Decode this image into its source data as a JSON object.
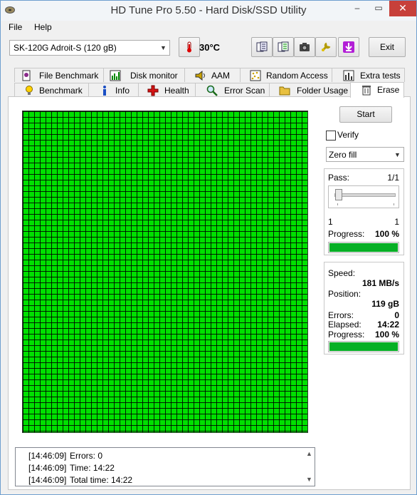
{
  "window": {
    "title": "HD Tune Pro 5.50 - Hard Disk/SSD Utility",
    "minimize": "–",
    "maximize": "▭",
    "close": "✕"
  },
  "menu": {
    "file": "File",
    "help": "Help"
  },
  "toolbar": {
    "drive": "SK-120G Adroit-S (120 gB)",
    "temperature": "30°C",
    "exit_label": "Exit"
  },
  "tabs_top": [
    {
      "label": "File Benchmark",
      "icon": "file-benchmark-icon"
    },
    {
      "label": "Disk monitor",
      "icon": "disk-monitor-icon"
    },
    {
      "label": "AAM",
      "icon": "speaker-icon"
    },
    {
      "label": "Random Access",
      "icon": "random-access-icon"
    },
    {
      "label": "Extra tests",
      "icon": "extra-tests-icon"
    }
  ],
  "tabs_bottom": [
    {
      "label": "Benchmark",
      "icon": "lightbulb-icon"
    },
    {
      "label": "Info",
      "icon": "info-icon"
    },
    {
      "label": "Health",
      "icon": "health-cross-icon"
    },
    {
      "label": "Error Scan",
      "icon": "magnifier-icon"
    },
    {
      "label": "Folder Usage",
      "icon": "folder-icon"
    },
    {
      "label": "Erase",
      "icon": "trash-icon",
      "active": true
    }
  ],
  "erase": {
    "start_label": "Start",
    "verify_label": "Verify",
    "verify_checked": false,
    "method": "Zero fill",
    "pass_label": "Pass:",
    "pass_value": "1/1",
    "slider_min": "1",
    "slider_max": "1",
    "progress_label": "Progress:",
    "progress_value": "100 %",
    "progress_fraction": 1.0,
    "speed_label": "Speed:",
    "speed_value": "181 MB/s",
    "position_label": "Position:",
    "position_value": "119 gB",
    "errors_label": "Errors:",
    "errors_value": "0",
    "elapsed_label": "Elapsed:",
    "elapsed_value": "14:22",
    "progress2_label": "Progress:",
    "progress2_value": "100 %",
    "progress2_fraction": 1.0,
    "block_color": "#00e000"
  },
  "log": [
    {
      "time": "[14:46:09]",
      "text": "Errors: 0"
    },
    {
      "time": "[14:46:09]",
      "text": "Time: 14:22"
    },
    {
      "time": "[14:46:09]",
      "text": "Total time: 14:22"
    }
  ],
  "colors": {
    "progress_green": "#06b025",
    "close_red": "#c7403a"
  }
}
